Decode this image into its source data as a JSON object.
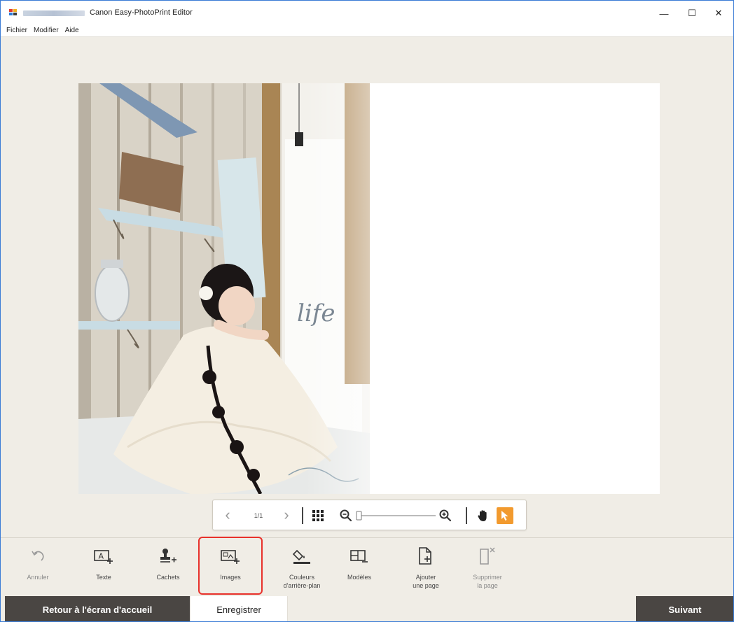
{
  "window": {
    "title": "Canon Easy-PhotoPrint Editor",
    "minimize_glyph": "—",
    "maximize_glyph": "☐",
    "close_glyph": "✕"
  },
  "menu": {
    "items": [
      {
        "label": "Fichier"
      },
      {
        "label": "Modifier"
      },
      {
        "label": "Aide"
      }
    ]
  },
  "photo": {
    "overlay_text": "life"
  },
  "navigation": {
    "page_counter": "1/1",
    "prev_glyph": "‹",
    "next_glyph": "›",
    "zoom_level_fraction": 0.0
  },
  "tools": [
    {
      "label": "Annuler",
      "icon": "undo-icon",
      "enabled": false
    },
    {
      "label": "Texte",
      "icon": "add-text-icon",
      "enabled": true
    },
    {
      "label": "Cachets",
      "icon": "stamp-icon",
      "enabled": true
    },
    {
      "label": "Images",
      "icon": "add-image-icon",
      "enabled": true,
      "highlighted": true
    },
    {
      "label": "Couleurs d'arrière-plan",
      "label_line1": "Couleurs",
      "label_line2": "d'arrière-plan",
      "icon": "background-color-icon",
      "enabled": true
    },
    {
      "label": "Modèles",
      "icon": "templates-icon",
      "enabled": true
    },
    {
      "label": "Ajouter une page",
      "label_line1": "Ajouter",
      "label_line2": "une page",
      "icon": "add-page-icon",
      "enabled": true
    },
    {
      "label": "Supprimer la page",
      "label_line1": "Supprimer",
      "label_line2": "la page",
      "icon": "delete-page-icon",
      "enabled": false
    }
  ],
  "bottom": {
    "home_label": "Retour à l'écran d'accueil",
    "save_label": "Enregistrer",
    "next_label": "Suivant"
  },
  "colors": {
    "accent_orange": "#f29a2e",
    "highlight_red": "#e8312b",
    "dark_button": "#4a4643",
    "workspace_bg": "#f0ede6"
  }
}
